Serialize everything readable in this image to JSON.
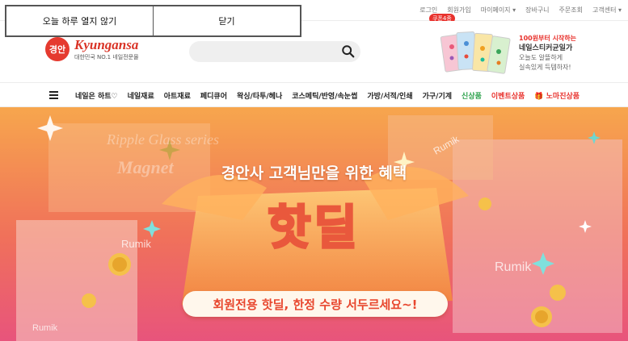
{
  "popup": {
    "hide_today": "오늘 하루 열지 않기",
    "close": "닫기"
  },
  "toplinks": [
    "로그인",
    "회원가입",
    "마이페이지 ▾",
    "장바구니",
    "주문조회",
    "고객센터 ▾"
  ],
  "coupon_badge": "쿠폰4종",
  "logo": {
    "mark": "경안",
    "brand": "Kyungansa",
    "tagline": "대한민국 NO.1 네일전문몰"
  },
  "search": {
    "value": "",
    "placeholder": ""
  },
  "promo": {
    "line1": "100원부터 시작하는",
    "line2": "네일스티커균일가",
    "line3": "오늘도 알뜰하게",
    "line4": "실속있게 득템하자!"
  },
  "nav": {
    "items": [
      {
        "label": "네일은 하트♡",
        "style": "normal"
      },
      {
        "label": "네일재료",
        "style": "normal"
      },
      {
        "label": "아트재료",
        "style": "normal"
      },
      {
        "label": "페디큐어",
        "style": "normal"
      },
      {
        "label": "왁싱/타투/헤나",
        "style": "normal"
      },
      {
        "label": "코스메틱/반영/속눈썹",
        "style": "normal"
      },
      {
        "label": "가방/서적/인쇄",
        "style": "normal"
      },
      {
        "label": "가구/기계",
        "style": "normal"
      },
      {
        "label": "신상품",
        "style": "new"
      },
      {
        "label": "이벤트상품",
        "style": "event"
      },
      {
        "label": "🎁 노마진상품",
        "style": "sale"
      }
    ]
  },
  "hero": {
    "subtitle": "경안사 고객님만을 위한 혜택",
    "title": "핫딜",
    "ribbon": "회원전용 핫딜, 한정 수량 서두르세요~!",
    "brand_marks": [
      "Rumik",
      "Rumik",
      "Rumik",
      "Rumik"
    ],
    "ghost_text": [
      "Ripple Glass series",
      "Magnet"
    ]
  },
  "colors": {
    "accent": "#e8322d",
    "hero_top": "#f6a24a",
    "hero_bottom": "#e94f7c",
    "new": "#2aa04a"
  }
}
